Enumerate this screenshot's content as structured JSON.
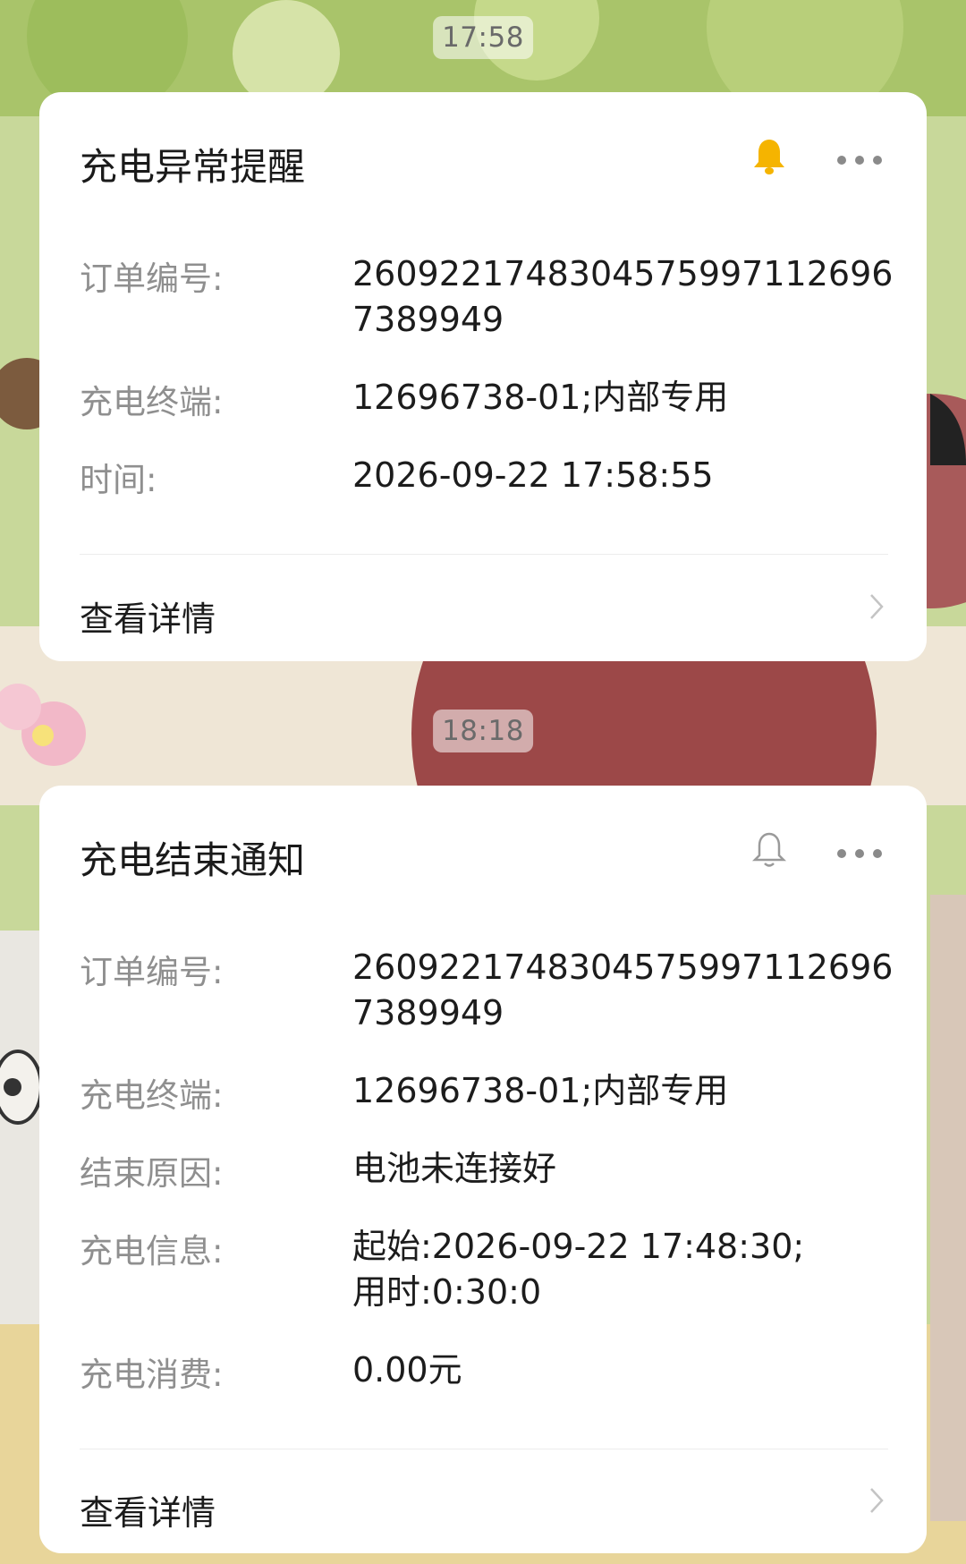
{
  "time_stamps": [
    "17:58",
    "18:18"
  ],
  "card1": {
    "title": "充电异常提醒",
    "bell_icon": "bell-filled-icon",
    "accent_color": "#f5b400",
    "rows": [
      {
        "label": "订单编号:",
        "value": "26092217483045759971126967389949"
      },
      {
        "label": "充电终端:",
        "value": "12696738-01;内部专用"
      },
      {
        "label": "时间:",
        "value": "2026-09-22 17:58:55"
      }
    ],
    "details_label": "查看详情"
  },
  "card2": {
    "title": "充电结束通知",
    "bell_icon": "bell-outline-icon",
    "rows": [
      {
        "label": "订单编号:",
        "value": "26092217483045759971126967389949"
      },
      {
        "label": "充电终端:",
        "value": "12696738-01;内部专用"
      },
      {
        "label": "结束原因:",
        "value": "电池未连接好"
      },
      {
        "label": "充电信息:",
        "value": "起始:2026-09-22 17:48:30;用时:0:30:0"
      },
      {
        "label": "充电消费:",
        "value": "0.00元"
      }
    ],
    "details_label": "查看详情"
  }
}
